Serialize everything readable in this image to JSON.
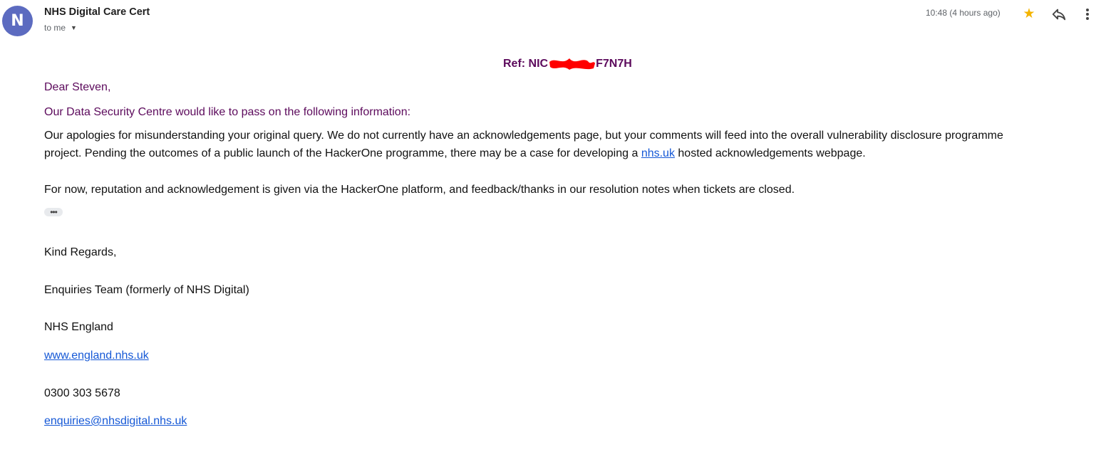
{
  "email": {
    "avatar_letter": "N",
    "sender": "NHS Digital Care Cert",
    "recipient": "to me",
    "time": "10:48 (4 hours ago)",
    "ref_prefix": "Ref: NIC",
    "ref_suffix": "F7N7H",
    "greeting": "Dear Steven,",
    "intro": "Our Data Security Centre would like to pass on the following information:",
    "para1_line1": "Our apologies for misunderstanding your original query. We do not currently have an acknowledgements page, but your comments will feed into the overall vulnerability disclosure programme",
    "para1_line2_pre": "project. Pending the outcomes of a public launch of the HackerOne programme, there may be a case for developing a ",
    "para1_link": "nhs.uk",
    "para1_line2_post": " hosted acknowledgements webpage.",
    "para2": "For now, reputation and acknowledgement is given via the HackerOne platform, and feedback/thanks in our resolution notes when tickets are closed.",
    "ellipsis": "•••",
    "closing": "Kind Regards,",
    "team": "Enquiries Team (formerly of NHS Digital)",
    "org": "NHS England",
    "website": "www.england.nhs.uk",
    "phone": "0300 303 5678",
    "email_address": "enquiries@nhsdigital.nhs.uk"
  },
  "icons": {
    "star": "star-icon",
    "reply": "reply-icon",
    "more": "more-vert-icon",
    "caret": "caret-down-icon"
  },
  "colors": {
    "avatar": "#5c6bc0",
    "star": "#f4b400",
    "purple_text": "#5c0a5c",
    "link": "#1558d6",
    "redaction": "#ff0000"
  }
}
